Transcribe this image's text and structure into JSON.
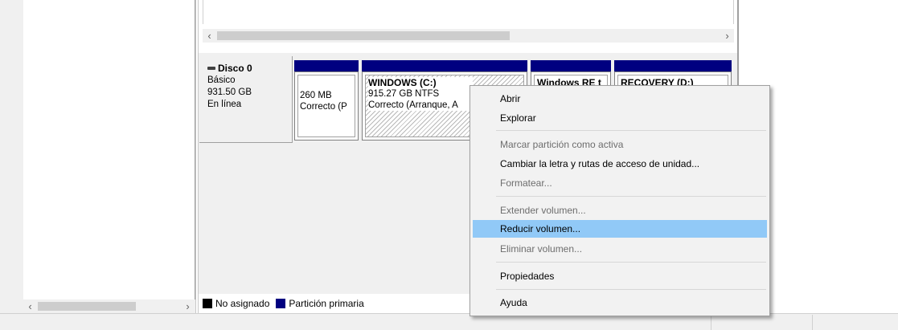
{
  "disk": {
    "title": "Disco 0",
    "type": "Básico",
    "size": "931.50 GB",
    "status": "En línea"
  },
  "partitions": [
    {
      "name": "",
      "size": "260 MB",
      "status": "Correcto (P"
    },
    {
      "name": "WINDOWS  (C:)",
      "size": "915.27 GB NTFS",
      "status": "Correcto (Arranque, A"
    },
    {
      "name": "Windows RE t",
      "size": "",
      "status": ""
    },
    {
      "name": "RECOVERY  (D:)",
      "size": "",
      "status": ""
    }
  ],
  "legend": {
    "unallocated": "No asignado",
    "primary": "Partición primaria",
    "unallocated_color": "#000000",
    "primary_color": "#000080"
  },
  "context_menu": {
    "items": [
      {
        "label": "Abrir",
        "enabled": true
      },
      {
        "label": "Explorar",
        "enabled": true
      },
      {
        "label": "Marcar partición como activa",
        "enabled": false
      },
      {
        "label": "Cambiar la letra y rutas de acceso de unidad...",
        "enabled": true
      },
      {
        "label": "Formatear...",
        "enabled": false
      },
      {
        "label": "Extender volumen...",
        "enabled": false
      },
      {
        "label": "Reducir volumen...",
        "enabled": true,
        "highlighted": true
      },
      {
        "label": "Eliminar volumen...",
        "enabled": false
      },
      {
        "label": "Propiedades",
        "enabled": true
      },
      {
        "label": "Ayuda",
        "enabled": true
      }
    ]
  },
  "scroll": {
    "left_arrow": "‹",
    "right_arrow": "›"
  },
  "colors": {
    "partition_header": "#000080",
    "menu_highlight": "#91c9f7",
    "disabled_text": "#6d6d6d"
  }
}
